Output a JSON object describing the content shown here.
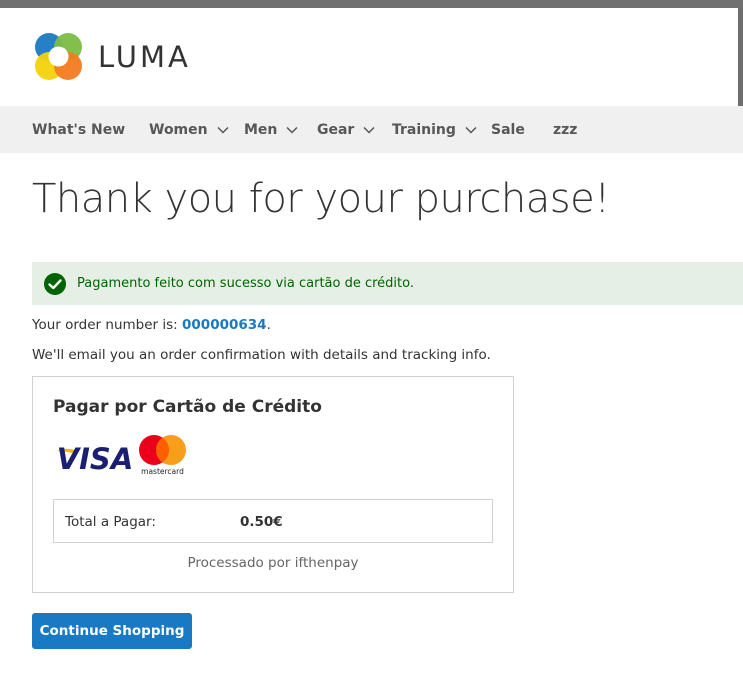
{
  "brand": {
    "logo_text": "LUMA"
  },
  "nav": {
    "items": [
      {
        "label": "What's New"
      },
      {
        "label": "Women"
      },
      {
        "label": "Men"
      },
      {
        "label": "Gear"
      },
      {
        "label": "Training"
      },
      {
        "label": "Sale"
      },
      {
        "label": "zzz"
      }
    ]
  },
  "page": {
    "title": "Thank you for your purchase!",
    "success_message": "Pagamento feito com sucesso via cartão de crédito.",
    "order_prefix": "Your order number is: ",
    "order_number": "000000634",
    "order_suffix": ".",
    "email_note": "We'll email you an order confirmation with details and tracking info."
  },
  "payment": {
    "title": "Pagar por Cartão de Crédito",
    "visa_text": "VISA",
    "mastercard_text": "mastercard",
    "total_label": "Total a Pagar:",
    "total_value": "0.50€",
    "processed_by": "Processado por ifthenpay"
  },
  "actions": {
    "continue_label": "Continue Shopping"
  },
  "colors": {
    "accent": "#1979c3",
    "success_bg": "#e5efe5",
    "success_text": "#006400",
    "nav_bg": "#f0f0f0",
    "visa_blue": "#1a1f71",
    "visa_gold": "#f7b600",
    "mc_red": "#eb001b",
    "mc_orange": "#f79e1b"
  }
}
